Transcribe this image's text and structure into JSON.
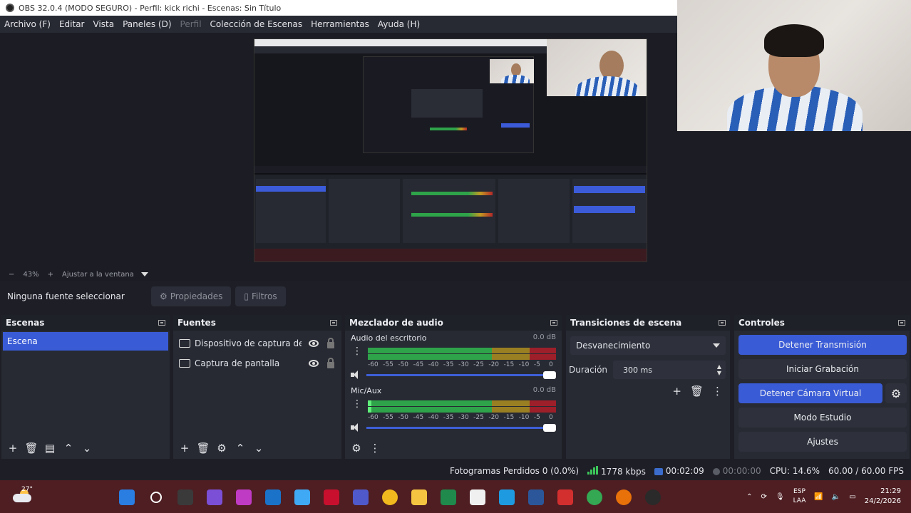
{
  "window": {
    "title": "OBS 32.0.4 (MODO SEGURO) - Perfil: kick richi - Escenas: Sin Título"
  },
  "menu": {
    "items": [
      {
        "label": "Archivo (F)",
        "enabled": true
      },
      {
        "label": "Editar",
        "enabled": true
      },
      {
        "label": "Vista",
        "enabled": true
      },
      {
        "label": "Paneles (D)",
        "enabled": true
      },
      {
        "label": "Perfil",
        "enabled": false
      },
      {
        "label": "Colección de Escenas",
        "enabled": true
      },
      {
        "label": "Herramientas",
        "enabled": true
      },
      {
        "label": "Ayuda (H)",
        "enabled": true
      }
    ]
  },
  "zoom": {
    "minus": "−",
    "level": "43%",
    "plus": "+",
    "fit_label": "Ajustar a la ventana"
  },
  "source_toolbar": {
    "no_source": "Ninguna fuente seleccionar",
    "properties": "Propiedades",
    "filters": "Filtros"
  },
  "scenes": {
    "title": "Escenas",
    "items": [
      "Escena"
    ],
    "selected": "Escena"
  },
  "sources": {
    "title": "Fuentes",
    "items": [
      {
        "label": "Dispositivo de captura de v",
        "icon": "camera-icon"
      },
      {
        "label": "Captura de pantalla",
        "icon": "monitor-icon"
      }
    ]
  },
  "mixer": {
    "title": "Mezclador de audio",
    "ticks": [
      "-60",
      "-55",
      "-50",
      "-45",
      "-40",
      "-35",
      "-30",
      "-25",
      "-20",
      "-15",
      "-10",
      "-5",
      "0"
    ],
    "channels": [
      {
        "name": "Audio del escritorio",
        "db": "0.0 dB",
        "level": 0.0
      },
      {
        "name": "Mic/Aux",
        "db": "0.0 dB",
        "level": 0.02
      }
    ],
    "colors": {
      "green": "#2fa34a",
      "yellow": "#9a7f22",
      "red": "#9c1f2a",
      "slider": "#3e5fd8"
    }
  },
  "transitions": {
    "title": "Transiciones de escena",
    "selected": "Desvanecimiento",
    "duration_label": "Duración",
    "duration_value": "300 ms"
  },
  "controls": {
    "title": "Controles",
    "stop_stream": "Detener Transmisión",
    "start_recording": "Iniciar Grabación",
    "stop_virtual_cam": "Detener Cámara Virtual",
    "studio_mode": "Modo Estudio",
    "settings": "Ajustes",
    "accent": "#3a5bd6"
  },
  "status": {
    "dropped_frames": "Fotogramas Perdidos 0 (0.0%)",
    "bitrate": "1778 kbps",
    "stream_time": "00:02:09",
    "rec_time": "00:00:00",
    "cpu": "CPU: 14.6%",
    "fps": "60.00 / 60.00 FPS"
  },
  "taskbar": {
    "temperature": "27°",
    "apps": [
      "windows-start-icon",
      "search-icon",
      "task-view-icon",
      "copilot-icon",
      "clipchamp-icon",
      "hp-icon",
      "weather-app-icon",
      "mcafee-icon",
      "teams-icon",
      "chrome-icon",
      "file-explorer-icon",
      "store-icon",
      "calendar-icon",
      "edge-icon",
      "word-icon",
      "acrobat-icon",
      "chrome-profile-icon",
      "chrome-profile-2-icon",
      "obs-icon"
    ],
    "lang_top": "ESP",
    "lang_bottom": "LAA",
    "time": "21:29",
    "date": "24/2/2026"
  }
}
